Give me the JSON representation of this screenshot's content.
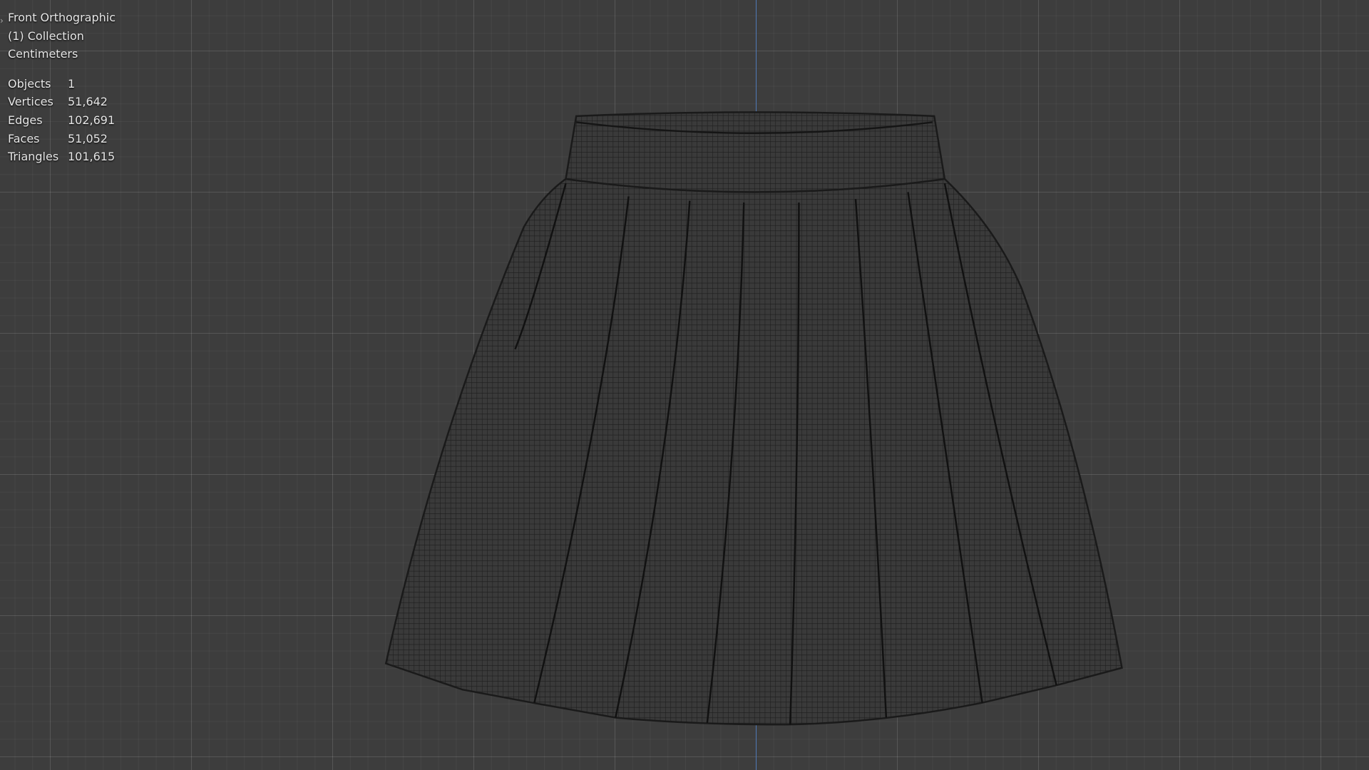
{
  "viewport": {
    "view_name": "Front Orthographic",
    "collection": "(1) Collection",
    "units": "Centimeters",
    "stats": [
      {
        "label": "Objects",
        "value": "1"
      },
      {
        "label": "Vertices",
        "value": "51,642"
      },
      {
        "label": "Edges",
        "value": "102,691"
      },
      {
        "label": "Faces",
        "value": "51,052"
      },
      {
        "label": "Triangles",
        "value": "101,615"
      }
    ],
    "axis_color": "#4f79b8",
    "background_color": "#3d3d3d",
    "object": "pleated-skirt-wireframe"
  }
}
